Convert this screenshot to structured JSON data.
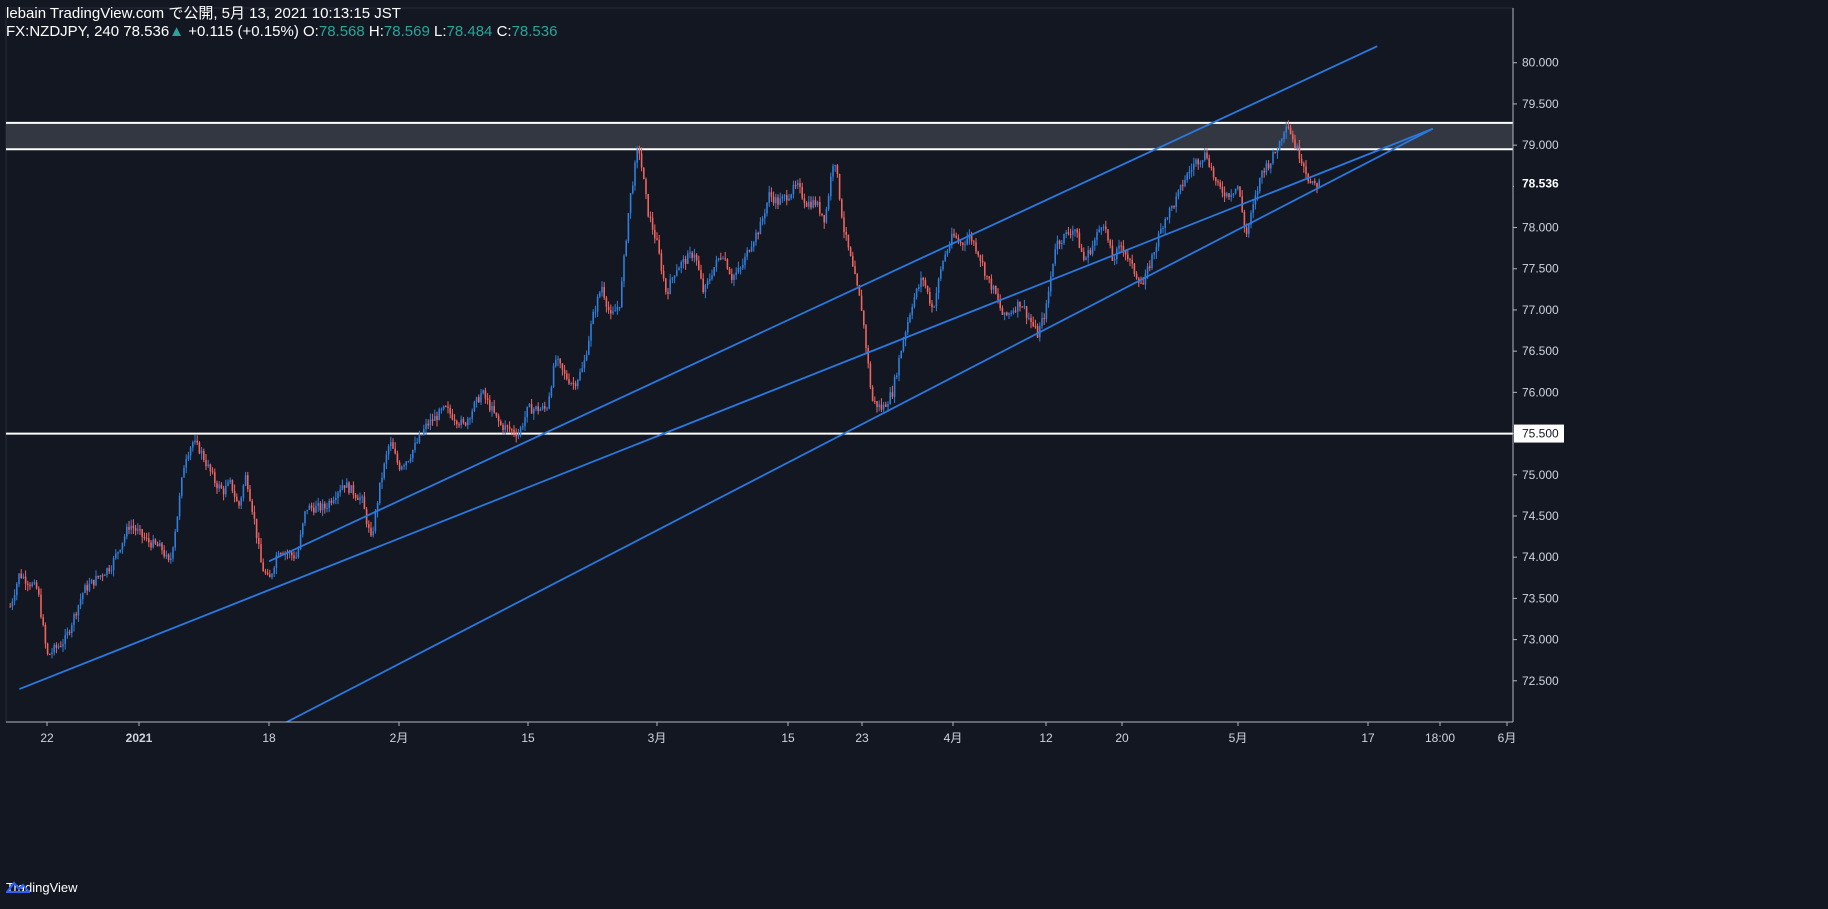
{
  "header": {
    "line1": "lebain TradingView.com で公開, 5月 13, 2021 10:13:15 JST",
    "symbol": "FX:NZDJPY, 240",
    "last": "78.536",
    "change": "+0.115 (+0.15%)",
    "o_label": "O:",
    "o_val": "78.568",
    "h_label": "H:",
    "h_val": "78.569",
    "l_label": "L:",
    "l_val": "78.484",
    "c_label": "C:",
    "c_val": "78.536"
  },
  "footer": {
    "brand": "TradingView"
  },
  "colors": {
    "background": "#131722",
    "up": "#2f7fdc",
    "down": "#f0645f",
    "line": "#2979e0",
    "level": "#ffffff",
    "zone": "#3a3d47",
    "text": "#d1d4dc"
  },
  "chart_data": {
    "type": "candlestick",
    "symbol": "FX:NZDJPY",
    "interval": "240",
    "y_ticks": [
      "80.000",
      "79.500",
      "79.000",
      "78.500",
      "78.000",
      "77.500",
      "77.000",
      "76.500",
      "76.000",
      "75.500",
      "75.000",
      "74.500",
      "74.000",
      "73.500",
      "73.000",
      "72.500"
    ],
    "ylim": [
      72.0,
      80.3
    ],
    "x_ticks": [
      "22",
      "2021",
      "18",
      "2月",
      "15",
      "3月",
      "15",
      "23",
      "4月",
      "12",
      "20",
      "5月",
      "17",
      "18:00",
      "6月"
    ],
    "last_price_label": "78.536",
    "level_label": "75.500",
    "horizontal_levels": [
      75.5
    ],
    "resistance_zone": [
      78.95,
      79.27
    ],
    "channel_lines": [
      {
        "name": "upper",
        "from": [
          "2021-01-18",
          73.95
        ],
        "to": [
          "2021-05-18",
          80.2
        ]
      },
      {
        "name": "lower",
        "from": [
          "2021-01-12",
          71.6
        ],
        "to": [
          "2021-05-24",
          79.2
        ]
      },
      {
        "name": "mid",
        "from": [
          "2020-12-19",
          72.4
        ],
        "to": [
          "2021-05-24",
          79.2
        ]
      }
    ],
    "close_path": [
      [
        "2020-12-18",
        73.4
      ],
      [
        "2020-12-19",
        73.8
      ],
      [
        "2020-12-21",
        73.6
      ],
      [
        "2020-12-22",
        72.8
      ],
      [
        "2020-12-24",
        73.0
      ],
      [
        "2020-12-26",
        73.6
      ],
      [
        "2020-12-29",
        73.9
      ],
      [
        "2020-12-31",
        74.4
      ],
      [
        "2021-01-02",
        74.2
      ],
      [
        "2021-01-04",
        74.1
      ],
      [
        "2021-01-05",
        73.9
      ],
      [
        "2021-01-06",
        74.5
      ],
      [
        "2021-01-07",
        75.2
      ],
      [
        "2021-01-08",
        75.4
      ],
      [
        "2021-01-09",
        75.3
      ],
      [
        "2021-01-11",
        74.9
      ],
      [
        "2021-01-12",
        74.8
      ],
      [
        "2021-01-13",
        74.9
      ],
      [
        "2021-01-14",
        74.6
      ],
      [
        "2021-01-15",
        75.0
      ],
      [
        "2021-01-16",
        74.5
      ],
      [
        "2021-01-17",
        73.9
      ],
      [
        "2021-01-18",
        73.7
      ],
      [
        "2021-01-19",
        74.1
      ],
      [
        "2021-01-21",
        74.0
      ],
      [
        "2021-01-22",
        74.6
      ],
      [
        "2021-01-24",
        74.6
      ],
      [
        "2021-01-26",
        74.9
      ],
      [
        "2021-01-28",
        74.7
      ],
      [
        "2021-01-29",
        74.2
      ],
      [
        "2021-01-30",
        74.9
      ],
      [
        "2021-01-31",
        75.4
      ],
      [
        "2021-02-01",
        75.1
      ],
      [
        "2021-02-02",
        75.2
      ],
      [
        "2021-02-04",
        75.6
      ],
      [
        "2021-02-06",
        75.8
      ],
      [
        "2021-02-08",
        75.6
      ],
      [
        "2021-02-10",
        76.0
      ],
      [
        "2021-02-12",
        75.6
      ],
      [
        "2021-02-14",
        75.5
      ],
      [
        "2021-02-15",
        75.8
      ],
      [
        "2021-02-17",
        75.8
      ],
      [
        "2021-02-18",
        76.4
      ],
      [
        "2021-02-19",
        76.2
      ],
      [
        "2021-02-20",
        76.1
      ],
      [
        "2021-02-21",
        76.3
      ],
      [
        "2021-02-22",
        76.9
      ],
      [
        "2021-02-23",
        77.3
      ],
      [
        "2021-02-24",
        76.9
      ],
      [
        "2021-02-25",
        77.1
      ],
      [
        "2021-02-26",
        78.3
      ],
      [
        "2021-02-27",
        79.0
      ],
      [
        "2021-02-28",
        78.2
      ],
      [
        "2021-03-01",
        77.8
      ],
      [
        "2021-03-02",
        77.2
      ],
      [
        "2021-03-03",
        77.5
      ],
      [
        "2021-03-04",
        77.6
      ],
      [
        "2021-03-05",
        77.7
      ],
      [
        "2021-03-06",
        77.2
      ],
      [
        "2021-03-07",
        77.5
      ],
      [
        "2021-03-08",
        77.7
      ],
      [
        "2021-03-09",
        77.4
      ],
      [
        "2021-03-10",
        77.5
      ],
      [
        "2021-03-11",
        77.8
      ],
      [
        "2021-03-12",
        78.0
      ],
      [
        "2021-03-13",
        78.4
      ],
      [
        "2021-03-14",
        78.3
      ],
      [
        "2021-03-15",
        78.4
      ],
      [
        "2021-03-16",
        78.5
      ],
      [
        "2021-03-17",
        78.3
      ],
      [
        "2021-03-18",
        78.3
      ],
      [
        "2021-03-19",
        78.1
      ],
      [
        "2021-03-20",
        78.9
      ],
      [
        "2021-03-21",
        78.0
      ],
      [
        "2021-03-22",
        77.5
      ],
      [
        "2021-03-23",
        77.0
      ],
      [
        "2021-03-24",
        75.9
      ],
      [
        "2021-03-25",
        75.8
      ],
      [
        "2021-03-26",
        76.0
      ],
      [
        "2021-03-27",
        76.6
      ],
      [
        "2021-03-28",
        77.1
      ],
      [
        "2021-03-29",
        77.4
      ],
      [
        "2021-03-30",
        77.0
      ],
      [
        "2021-03-31",
        77.6
      ],
      [
        "2021-04-01",
        77.9
      ],
      [
        "2021-04-02",
        77.8
      ],
      [
        "2021-04-03",
        77.9
      ],
      [
        "2021-04-04",
        77.7
      ],
      [
        "2021-04-05",
        77.4
      ],
      [
        "2021-04-06",
        77.2
      ],
      [
        "2021-04-07",
        76.9
      ],
      [
        "2021-04-08",
        77.0
      ],
      [
        "2021-04-09",
        77.1
      ],
      [
        "2021-04-10",
        76.9
      ],
      [
        "2021-04-11",
        76.7
      ],
      [
        "2021-04-12",
        77.0
      ],
      [
        "2021-04-13",
        77.8
      ],
      [
        "2021-04-14",
        77.9
      ],
      [
        "2021-04-15",
        78.0
      ],
      [
        "2021-04-16",
        77.6
      ],
      [
        "2021-04-17",
        77.8
      ],
      [
        "2021-04-18",
        78.1
      ],
      [
        "2021-04-19",
        77.6
      ],
      [
        "2021-04-20",
        77.8
      ],
      [
        "2021-04-21",
        77.5
      ],
      [
        "2021-04-22",
        77.3
      ],
      [
        "2021-04-23",
        77.7
      ],
      [
        "2021-04-24",
        78.1
      ],
      [
        "2021-04-25",
        78.3
      ],
      [
        "2021-04-26",
        78.6
      ],
      [
        "2021-04-27",
        78.8
      ],
      [
        "2021-04-28",
        78.9
      ],
      [
        "2021-04-29",
        78.5
      ],
      [
        "2021-04-30",
        78.4
      ],
      [
        "2021-05-01",
        78.5
      ],
      [
        "2021-05-02",
        77.9
      ],
      [
        "2021-05-03",
        78.3
      ],
      [
        "2021-05-04",
        78.7
      ],
      [
        "2021-05-05",
        78.8
      ],
      [
        "2021-05-06",
        79.0
      ],
      [
        "2021-05-07",
        79.3
      ],
      [
        "2021-05-08",
        79.0
      ],
      [
        "2021-05-09",
        78.8
      ],
      [
        "2021-05-10",
        78.5
      ],
      [
        "2021-05-11",
        78.536
      ]
    ]
  }
}
